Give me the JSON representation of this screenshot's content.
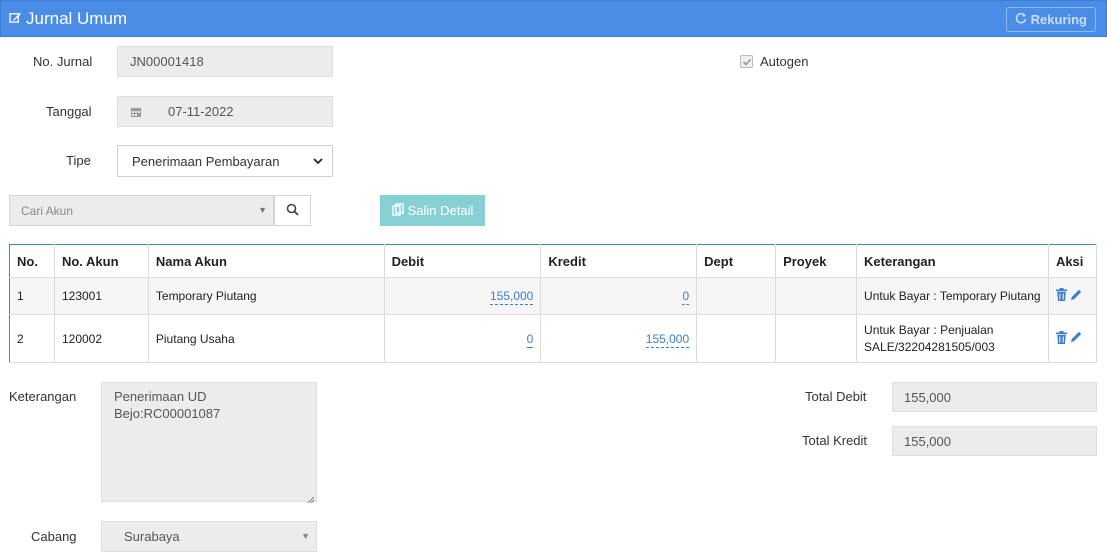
{
  "header": {
    "title": "Jurnal Umum",
    "rekuring_label": "Rekuring"
  },
  "form": {
    "no_jurnal_label": "No. Jurnal",
    "no_jurnal_value": "JN00001418",
    "autogen_label": "Autogen",
    "autogen_checked": true,
    "tanggal_label": "Tanggal",
    "tanggal_value": "07-11-2022",
    "tipe_label": "Tipe",
    "tipe_value": "Penerimaan Pembayaran",
    "cari_placeholder": "Cari Akun",
    "salin_label": "Salin Detail"
  },
  "table": {
    "headers": [
      "No.",
      "No. Akun",
      "Nama Akun",
      "Debit",
      "Kredit",
      "Dept",
      "Proyek",
      "Keterangan",
      "Aksi"
    ],
    "rows": [
      {
        "no": "1",
        "akun": "123001",
        "nama": "Temporary Piutang",
        "debit": "155,000",
        "kredit": "0",
        "dept": "",
        "proyek": "",
        "keterangan": "Untuk Bayar : Temporary Piutang"
      },
      {
        "no": "2",
        "akun": "120002",
        "nama": "Piutang Usaha",
        "debit": "0",
        "kredit": "155,000",
        "dept": "",
        "proyek": "",
        "keterangan": "Untuk Bayar : Penjualan SALE/32204281505/003"
      }
    ]
  },
  "footer": {
    "keterangan_label": "Keterangan",
    "keterangan_value": "Penerimaan UD\nBejo:RC00001087",
    "total_debit_label": "Total Debit",
    "total_debit_value": "155,000",
    "total_kredit_label": "Total Kredit",
    "total_kredit_value": "155,000",
    "cabang_label": "Cabang",
    "cabang_value": "Surabaya"
  },
  "colors": {
    "header_bg": "#4a8de6",
    "salin_bg": "#86d0d4",
    "link_blue": "#3b80c9"
  }
}
